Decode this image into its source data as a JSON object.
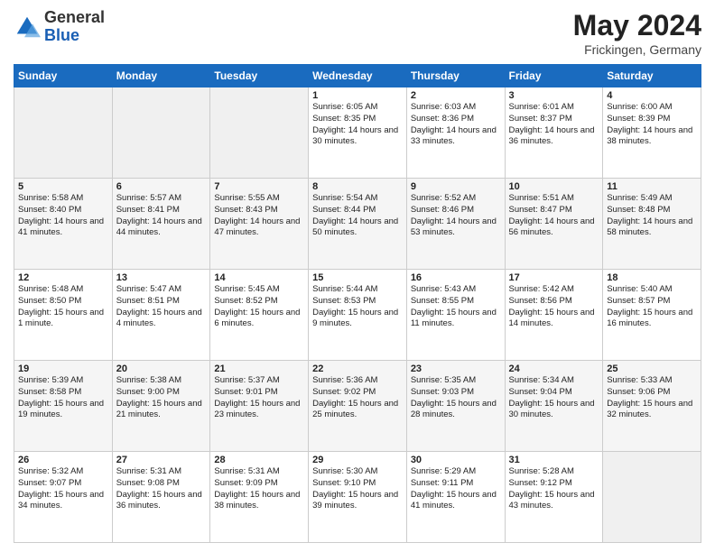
{
  "header": {
    "logo_general": "General",
    "logo_blue": "Blue",
    "title": "May 2024",
    "location": "Frickingen, Germany"
  },
  "days": [
    "Sunday",
    "Monday",
    "Tuesday",
    "Wednesday",
    "Thursday",
    "Friday",
    "Saturday"
  ],
  "weeks": [
    {
      "days": [
        {
          "num": "",
          "text": ""
        },
        {
          "num": "",
          "text": ""
        },
        {
          "num": "",
          "text": ""
        },
        {
          "num": "1",
          "text": "Sunrise: 6:05 AM\nSunset: 8:35 PM\nDaylight: 14 hours and 30 minutes."
        },
        {
          "num": "2",
          "text": "Sunrise: 6:03 AM\nSunset: 8:36 PM\nDaylight: 14 hours and 33 minutes."
        },
        {
          "num": "3",
          "text": "Sunrise: 6:01 AM\nSunset: 8:37 PM\nDaylight: 14 hours and 36 minutes."
        },
        {
          "num": "4",
          "text": "Sunrise: 6:00 AM\nSunset: 8:39 PM\nDaylight: 14 hours and 38 minutes."
        }
      ]
    },
    {
      "days": [
        {
          "num": "5",
          "text": "Sunrise: 5:58 AM\nSunset: 8:40 PM\nDaylight: 14 hours and 41 minutes."
        },
        {
          "num": "6",
          "text": "Sunrise: 5:57 AM\nSunset: 8:41 PM\nDaylight: 14 hours and 44 minutes."
        },
        {
          "num": "7",
          "text": "Sunrise: 5:55 AM\nSunset: 8:43 PM\nDaylight: 14 hours and 47 minutes."
        },
        {
          "num": "8",
          "text": "Sunrise: 5:54 AM\nSunset: 8:44 PM\nDaylight: 14 hours and 50 minutes."
        },
        {
          "num": "9",
          "text": "Sunrise: 5:52 AM\nSunset: 8:46 PM\nDaylight: 14 hours and 53 minutes."
        },
        {
          "num": "10",
          "text": "Sunrise: 5:51 AM\nSunset: 8:47 PM\nDaylight: 14 hours and 56 minutes."
        },
        {
          "num": "11",
          "text": "Sunrise: 5:49 AM\nSunset: 8:48 PM\nDaylight: 14 hours and 58 minutes."
        }
      ]
    },
    {
      "days": [
        {
          "num": "12",
          "text": "Sunrise: 5:48 AM\nSunset: 8:50 PM\nDaylight: 15 hours and 1 minute."
        },
        {
          "num": "13",
          "text": "Sunrise: 5:47 AM\nSunset: 8:51 PM\nDaylight: 15 hours and 4 minutes."
        },
        {
          "num": "14",
          "text": "Sunrise: 5:45 AM\nSunset: 8:52 PM\nDaylight: 15 hours and 6 minutes."
        },
        {
          "num": "15",
          "text": "Sunrise: 5:44 AM\nSunset: 8:53 PM\nDaylight: 15 hours and 9 minutes."
        },
        {
          "num": "16",
          "text": "Sunrise: 5:43 AM\nSunset: 8:55 PM\nDaylight: 15 hours and 11 minutes."
        },
        {
          "num": "17",
          "text": "Sunrise: 5:42 AM\nSunset: 8:56 PM\nDaylight: 15 hours and 14 minutes."
        },
        {
          "num": "18",
          "text": "Sunrise: 5:40 AM\nSunset: 8:57 PM\nDaylight: 15 hours and 16 minutes."
        }
      ]
    },
    {
      "days": [
        {
          "num": "19",
          "text": "Sunrise: 5:39 AM\nSunset: 8:58 PM\nDaylight: 15 hours and 19 minutes."
        },
        {
          "num": "20",
          "text": "Sunrise: 5:38 AM\nSunset: 9:00 PM\nDaylight: 15 hours and 21 minutes."
        },
        {
          "num": "21",
          "text": "Sunrise: 5:37 AM\nSunset: 9:01 PM\nDaylight: 15 hours and 23 minutes."
        },
        {
          "num": "22",
          "text": "Sunrise: 5:36 AM\nSunset: 9:02 PM\nDaylight: 15 hours and 25 minutes."
        },
        {
          "num": "23",
          "text": "Sunrise: 5:35 AM\nSunset: 9:03 PM\nDaylight: 15 hours and 28 minutes."
        },
        {
          "num": "24",
          "text": "Sunrise: 5:34 AM\nSunset: 9:04 PM\nDaylight: 15 hours and 30 minutes."
        },
        {
          "num": "25",
          "text": "Sunrise: 5:33 AM\nSunset: 9:06 PM\nDaylight: 15 hours and 32 minutes."
        }
      ]
    },
    {
      "days": [
        {
          "num": "26",
          "text": "Sunrise: 5:32 AM\nSunset: 9:07 PM\nDaylight: 15 hours and 34 minutes."
        },
        {
          "num": "27",
          "text": "Sunrise: 5:31 AM\nSunset: 9:08 PM\nDaylight: 15 hours and 36 minutes."
        },
        {
          "num": "28",
          "text": "Sunrise: 5:31 AM\nSunset: 9:09 PM\nDaylight: 15 hours and 38 minutes."
        },
        {
          "num": "29",
          "text": "Sunrise: 5:30 AM\nSunset: 9:10 PM\nDaylight: 15 hours and 39 minutes."
        },
        {
          "num": "30",
          "text": "Sunrise: 5:29 AM\nSunset: 9:11 PM\nDaylight: 15 hours and 41 minutes."
        },
        {
          "num": "31",
          "text": "Sunrise: 5:28 AM\nSunset: 9:12 PM\nDaylight: 15 hours and 43 minutes."
        },
        {
          "num": "",
          "text": ""
        }
      ]
    }
  ]
}
